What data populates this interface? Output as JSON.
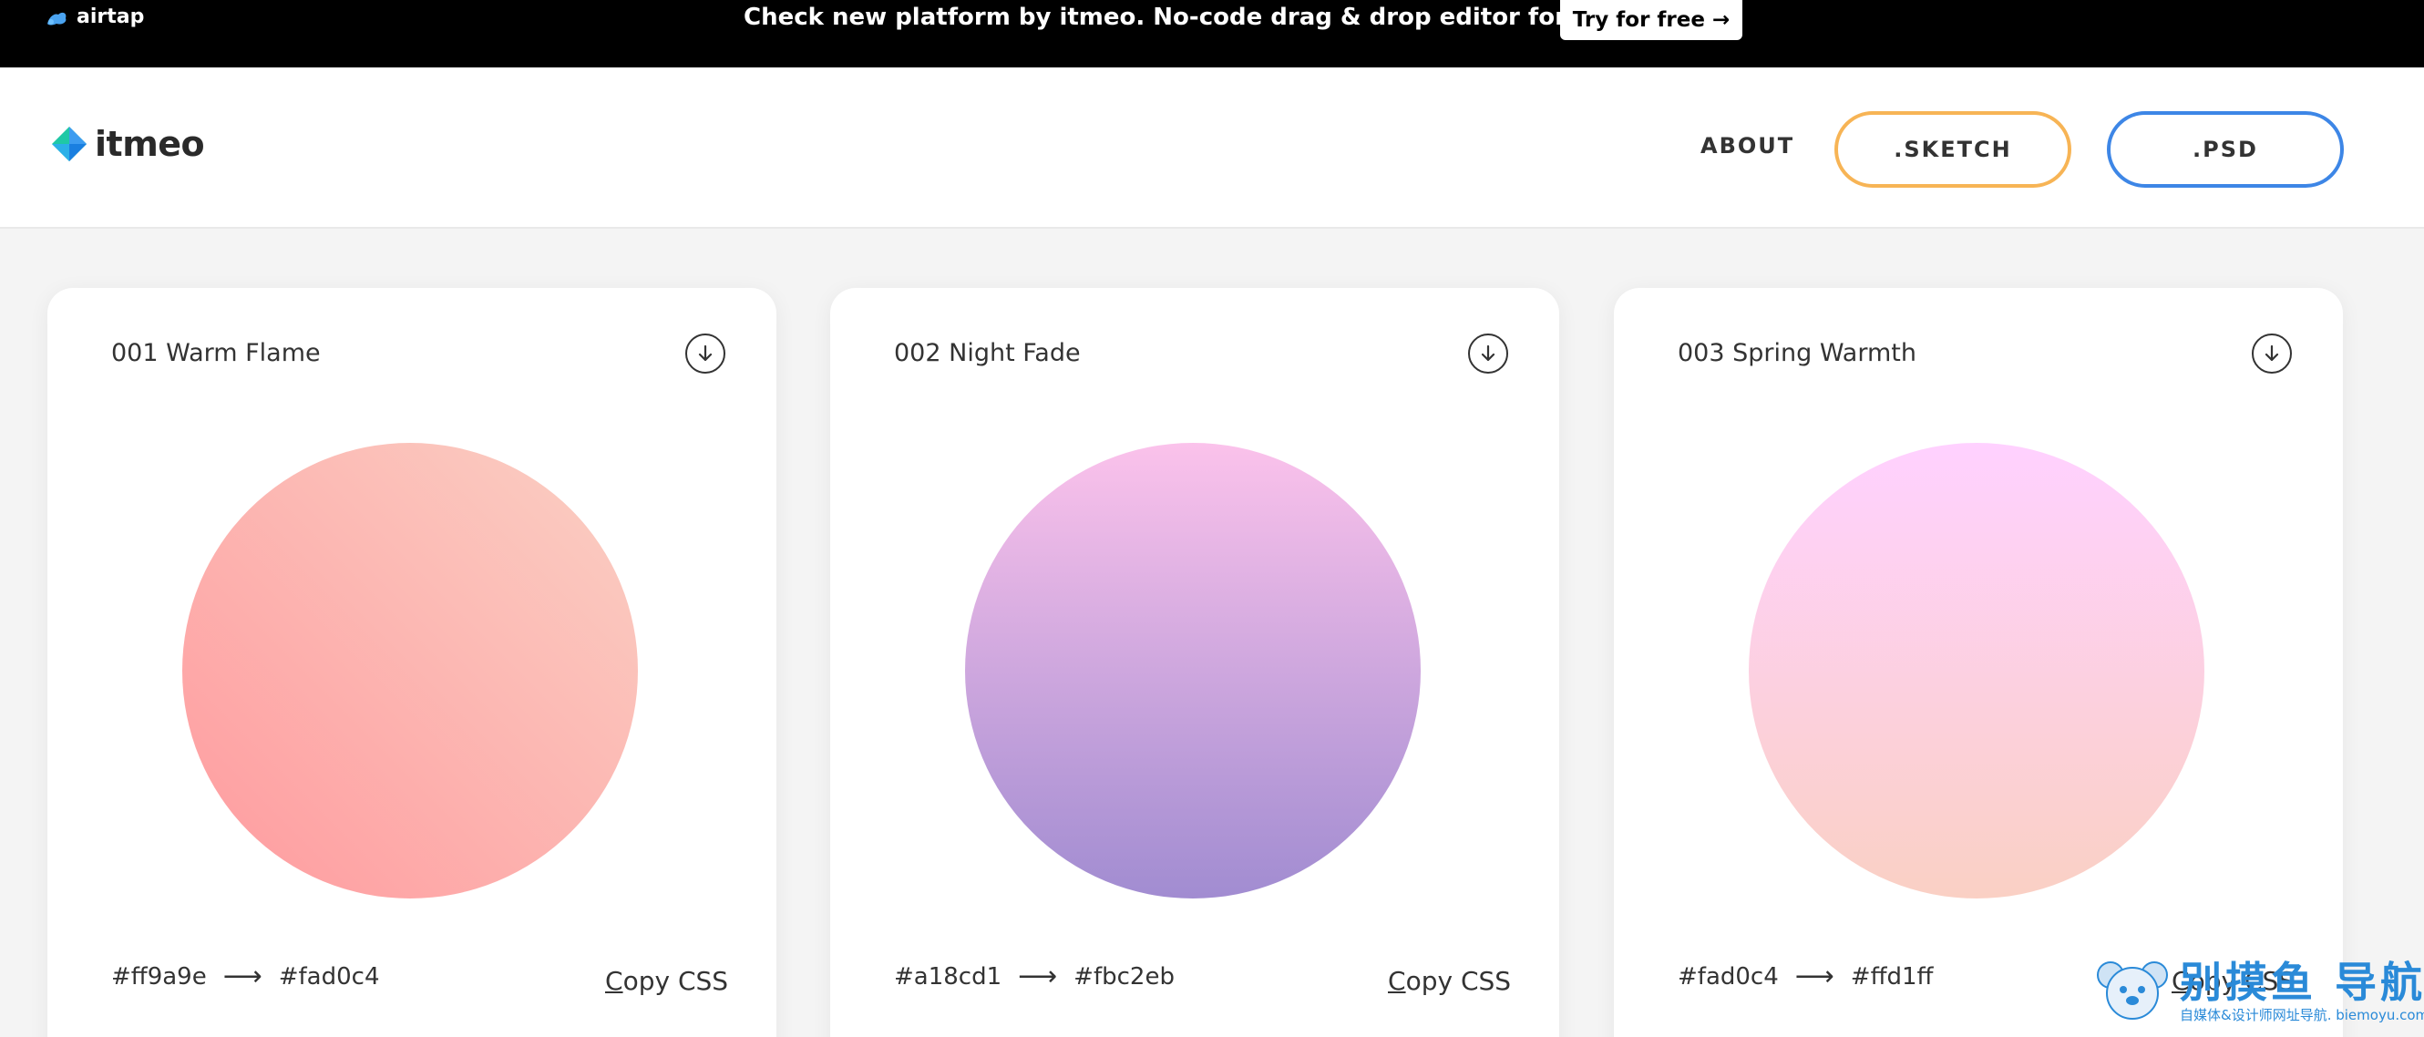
{
  "banner": {
    "brand": "airtap",
    "message": "Check new platform by itmeo. No-code drag & drop editor for creators.",
    "cta_label": "Try for free",
    "cta_arrow": "→"
  },
  "header": {
    "logo_text": "itmeo",
    "nav_about": "ABOUT",
    "sketch_label": ".SKETCH",
    "psd_label": ".PSD",
    "sketch_border_color": "#f7b455",
    "psd_border_color": "#3d86e6"
  },
  "cards": [
    {
      "title": "001 Warm Flame",
      "color_from": "#ff9a9e",
      "color_to": "#fad0c4",
      "arrow": "⟶",
      "copy_label_first": "C",
      "copy_label_rest": "opy CSS",
      "icon": "download-circle-icon"
    },
    {
      "title": "002 Night Fade",
      "color_from": "#a18cd1",
      "color_to": "#fbc2eb",
      "arrow": "⟶",
      "copy_label_first": "C",
      "copy_label_rest": "opy CSS",
      "icon": "download-circle-icon"
    },
    {
      "title": "003 Spring Warmth",
      "color_from": "#fad0c4",
      "color_to": "#ffd1ff",
      "arrow": "⟶",
      "copy_label_first": "C",
      "copy_label_rest": "opy CSS",
      "icon": "download-circle-icon"
    }
  ],
  "watermark": {
    "title": "别摸鱼 导航",
    "subtitle": "自媒体&设计师网址导航. biemoyu.com"
  }
}
